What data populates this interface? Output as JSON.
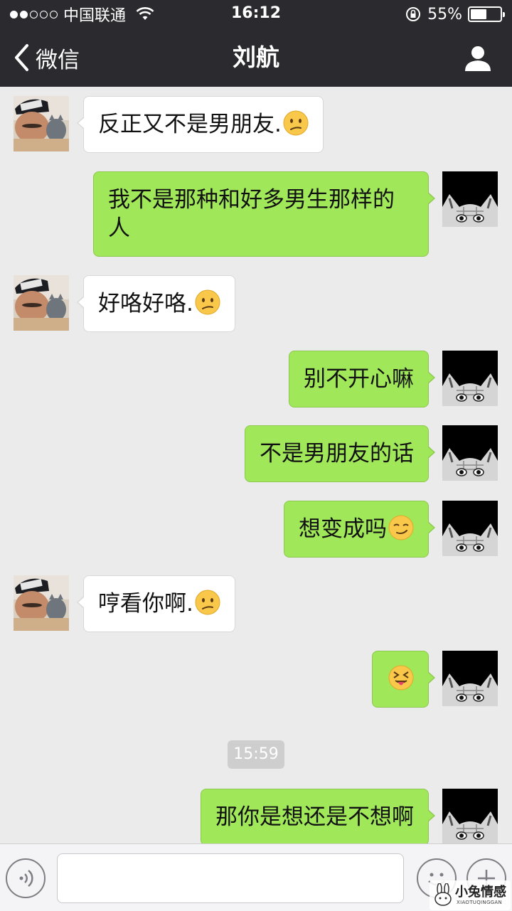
{
  "status_bar": {
    "carrier": "中国联通",
    "time": "16:12",
    "battery_percent": "55%",
    "battery_level": 0.55,
    "signal_bars_filled": 2,
    "signal_bars_total": 5
  },
  "nav": {
    "back_label": "微信",
    "title": "刘航",
    "profile_icon": "person-icon"
  },
  "messages": [
    {
      "side": "in",
      "text": "反正又不是男朋友.",
      "emoji": "confused-face"
    },
    {
      "side": "out",
      "text": "我不是那种和好多男生那样的人",
      "emoji": ""
    },
    {
      "side": "in",
      "text": "好咯好咯.",
      "emoji": "confused-face"
    },
    {
      "side": "out",
      "text": "别不开心嘛",
      "emoji": ""
    },
    {
      "side": "out",
      "text": "不是男朋友的话",
      "emoji": ""
    },
    {
      "side": "out",
      "text": "想变成吗",
      "emoji": "smirking-face"
    },
    {
      "side": "in",
      "text": "哼看你啊.",
      "emoji": "confused-face"
    },
    {
      "side": "out",
      "text": "",
      "emoji": "squinting-tongue-face"
    },
    {
      "side": "out",
      "text": "那你是想还是不想啊",
      "emoji": ""
    }
  ],
  "timestamp": "15:59",
  "input_bar": {
    "input_value": "",
    "voice_icon": "voice-icon",
    "emoji_icon": "emoji-icon",
    "plus_icon": "plus-icon"
  },
  "watermark": {
    "title": "小兔情感",
    "subtitle": "XIAOTUQINGGAN"
  },
  "colors": {
    "header_bg": "#2b2b2f",
    "chat_bg": "#ebebeb",
    "outgoing_bubble": "#a0e75a",
    "incoming_bubble": "#ffffff"
  }
}
